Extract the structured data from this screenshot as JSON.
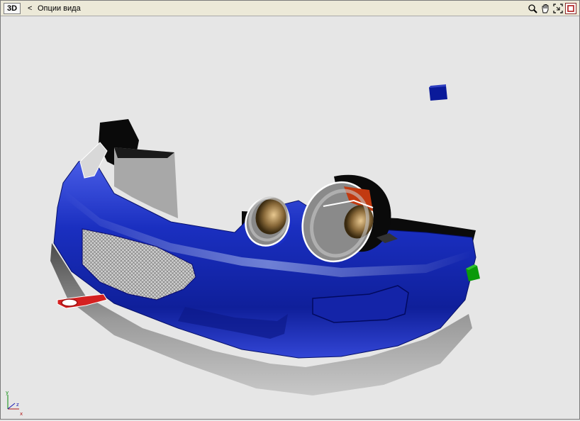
{
  "toolbar": {
    "view_mode": "3D",
    "back": "<",
    "view_options": "Опции вида",
    "tools": [
      {
        "icon": "zoom-icon"
      },
      {
        "icon": "pan-hand-icon"
      },
      {
        "icon": "fit-view-icon"
      },
      {
        "icon": "maximize-icon"
      }
    ]
  },
  "viewport": {
    "background": "#e6e6e6",
    "axis": {
      "y": "y",
      "z": "z",
      "x": "x"
    },
    "colors": {
      "body": "#1a2fc0",
      "mesh": "#9a9a9a",
      "hook": "#d42020",
      "marker_blue": "#0a1a9a",
      "marker_green": "#0a9a0a"
    }
  }
}
